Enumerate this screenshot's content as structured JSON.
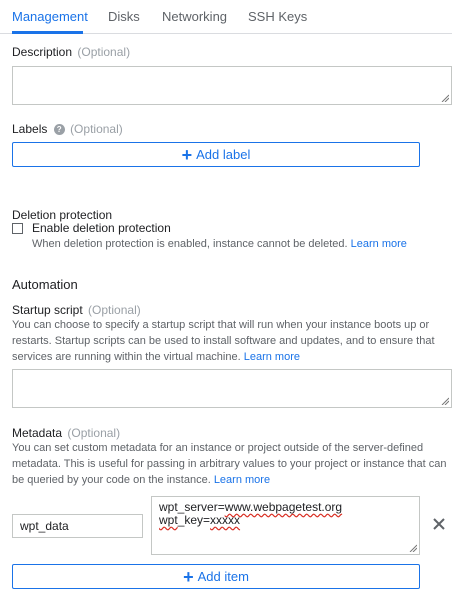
{
  "tabs": [
    "Management",
    "Disks",
    "Networking",
    "SSH Keys"
  ],
  "description": {
    "label": "Description",
    "optional": "(Optional)"
  },
  "labels": {
    "label": "Labels",
    "optional": "(Optional)",
    "add_label": "Add label"
  },
  "deletion": {
    "title": "Deletion protection",
    "checkbox_label": "Enable deletion protection",
    "hint": "When deletion protection is enabled, instance cannot be deleted.",
    "learn_more": "Learn more"
  },
  "automation": {
    "title": "Automation"
  },
  "startup_script": {
    "label": "Startup script",
    "optional": "(Optional)",
    "description": "You can choose to specify a startup script that will run when your instance boots up or restarts. Startup scripts can be used to install software and updates, and to ensure that services are running within the virtual machine.",
    "learn_more": "Learn more"
  },
  "metadata": {
    "label": "Metadata",
    "optional": "(Optional)",
    "description": "You can set custom metadata for an instance or project outside of the server-defined metadata. This is useful for passing in arbitrary values to your project or instance that can be queried by your code on the instance.",
    "learn_more": "Learn more",
    "key": "wpt_data",
    "value_line1": "wpt_server=www.webpagetest.org",
    "value_line2": "wpt_key=xxxxx",
    "add_item": "Add item"
  },
  "colors": {
    "accent": "#1a73e8",
    "muted": "#5f6368"
  },
  "icons": {
    "help": "help-icon",
    "plus": "plus-icon",
    "close": "close-icon"
  }
}
